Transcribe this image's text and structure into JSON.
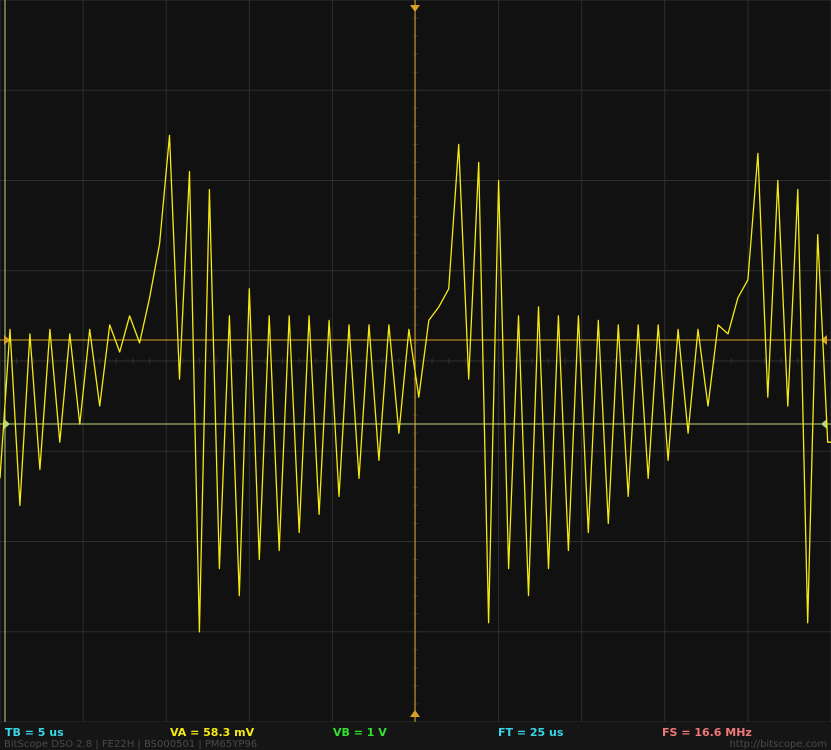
{
  "scope": {
    "colors": {
      "background": "#111111",
      "grid": "#2e2e2e",
      "trace": "#f5ea14",
      "trigger_marker": "#d9a028",
      "ref_line_b": "#b6d67a"
    },
    "grid": {
      "divisions_x": 10,
      "divisions_y": 8
    }
  },
  "status": {
    "tb": {
      "text": "TB = 5 us",
      "color": "#39d6e6"
    },
    "va": {
      "text": "VA = 58.3 mV",
      "color": "#f5ea14"
    },
    "vb": {
      "text": "VB = 1 V",
      "color": "#32e032"
    },
    "ft": {
      "text": "FT = 25 us",
      "color": "#39d6e6"
    },
    "fs": {
      "text": "FS = 16.6 MHz",
      "color": "#f07878"
    }
  },
  "footer": {
    "left": "BitScope DSO 2.8 | FE22H | BS000501 | PM65YP96",
    "right": "http://bitscope.com"
  },
  "chart_data": {
    "type": "line",
    "title": "",
    "xlabel": "",
    "ylabel": "",
    "xlim": [
      0,
      50
    ],
    "ylim": [
      -4,
      4
    ],
    "x_unit": "us",
    "y_unit": "div",
    "series": [
      {
        "x": [
          0,
          0.6,
          1.2,
          1.8,
          2.4,
          3.0,
          3.6,
          4.2,
          4.8,
          5.4,
          6.0,
          6.6,
          7.2,
          7.8,
          8.4,
          9.0,
          9.6,
          10.2,
          10.8,
          11.4,
          12.0,
          12.6,
          13.2,
          13.8,
          14.4,
          15.0,
          15.6,
          16.2,
          16.8,
          17.4,
          18.0,
          18.6,
          19.2,
          19.8,
          20.4,
          21.0,
          21.6,
          22.2,
          22.8,
          23.4,
          24.0,
          24.6,
          25.2,
          25.8,
          26.4,
          27.0,
          27.6,
          28.2,
          28.8,
          29.4,
          30.0,
          30.6,
          31.2,
          31.8,
          32.4,
          33.0,
          33.6,
          34.2,
          34.8,
          35.4,
          36.0,
          36.6,
          37.2,
          37.8,
          38.4,
          39.0,
          39.6,
          40.2,
          40.8,
          41.4,
          42.0,
          42.6,
          43.2,
          43.8,
          44.4,
          45.0,
          45.6,
          46.2,
          46.8,
          47.4,
          48.0,
          48.6,
          49.2,
          49.8,
          50.0
        ],
        "y": [
          -1.3,
          0.35,
          -1.6,
          0.3,
          -1.2,
          0.35,
          -0.9,
          0.3,
          -0.7,
          0.35,
          -0.5,
          0.4,
          0.1,
          0.5,
          0.2,
          0.7,
          1.3,
          2.5,
          -0.2,
          2.1,
          -3.0,
          1.9,
          -2.3,
          0.5,
          -2.6,
          0.8,
          -2.2,
          0.5,
          -2.1,
          0.5,
          -1.9,
          0.5,
          -1.7,
          0.45,
          -1.5,
          0.4,
          -1.3,
          0.4,
          -1.1,
          0.4,
          -0.8,
          0.35,
          -0.4,
          0.45,
          0.6,
          0.8,
          2.4,
          -0.2,
          2.2,
          -2.9,
          2.0,
          -2.3,
          0.5,
          -2.6,
          0.6,
          -2.3,
          0.5,
          -2.1,
          0.5,
          -1.9,
          0.45,
          -1.8,
          0.4,
          -1.5,
          0.4,
          -1.3,
          0.4,
          -1.1,
          0.35,
          -0.8,
          0.35,
          -0.5,
          0.4,
          0.3,
          0.7,
          0.9,
          2.3,
          -0.4,
          2.0,
          -0.5,
          1.9,
          -2.9,
          1.4,
          -0.9,
          -0.9
        ]
      }
    ]
  }
}
